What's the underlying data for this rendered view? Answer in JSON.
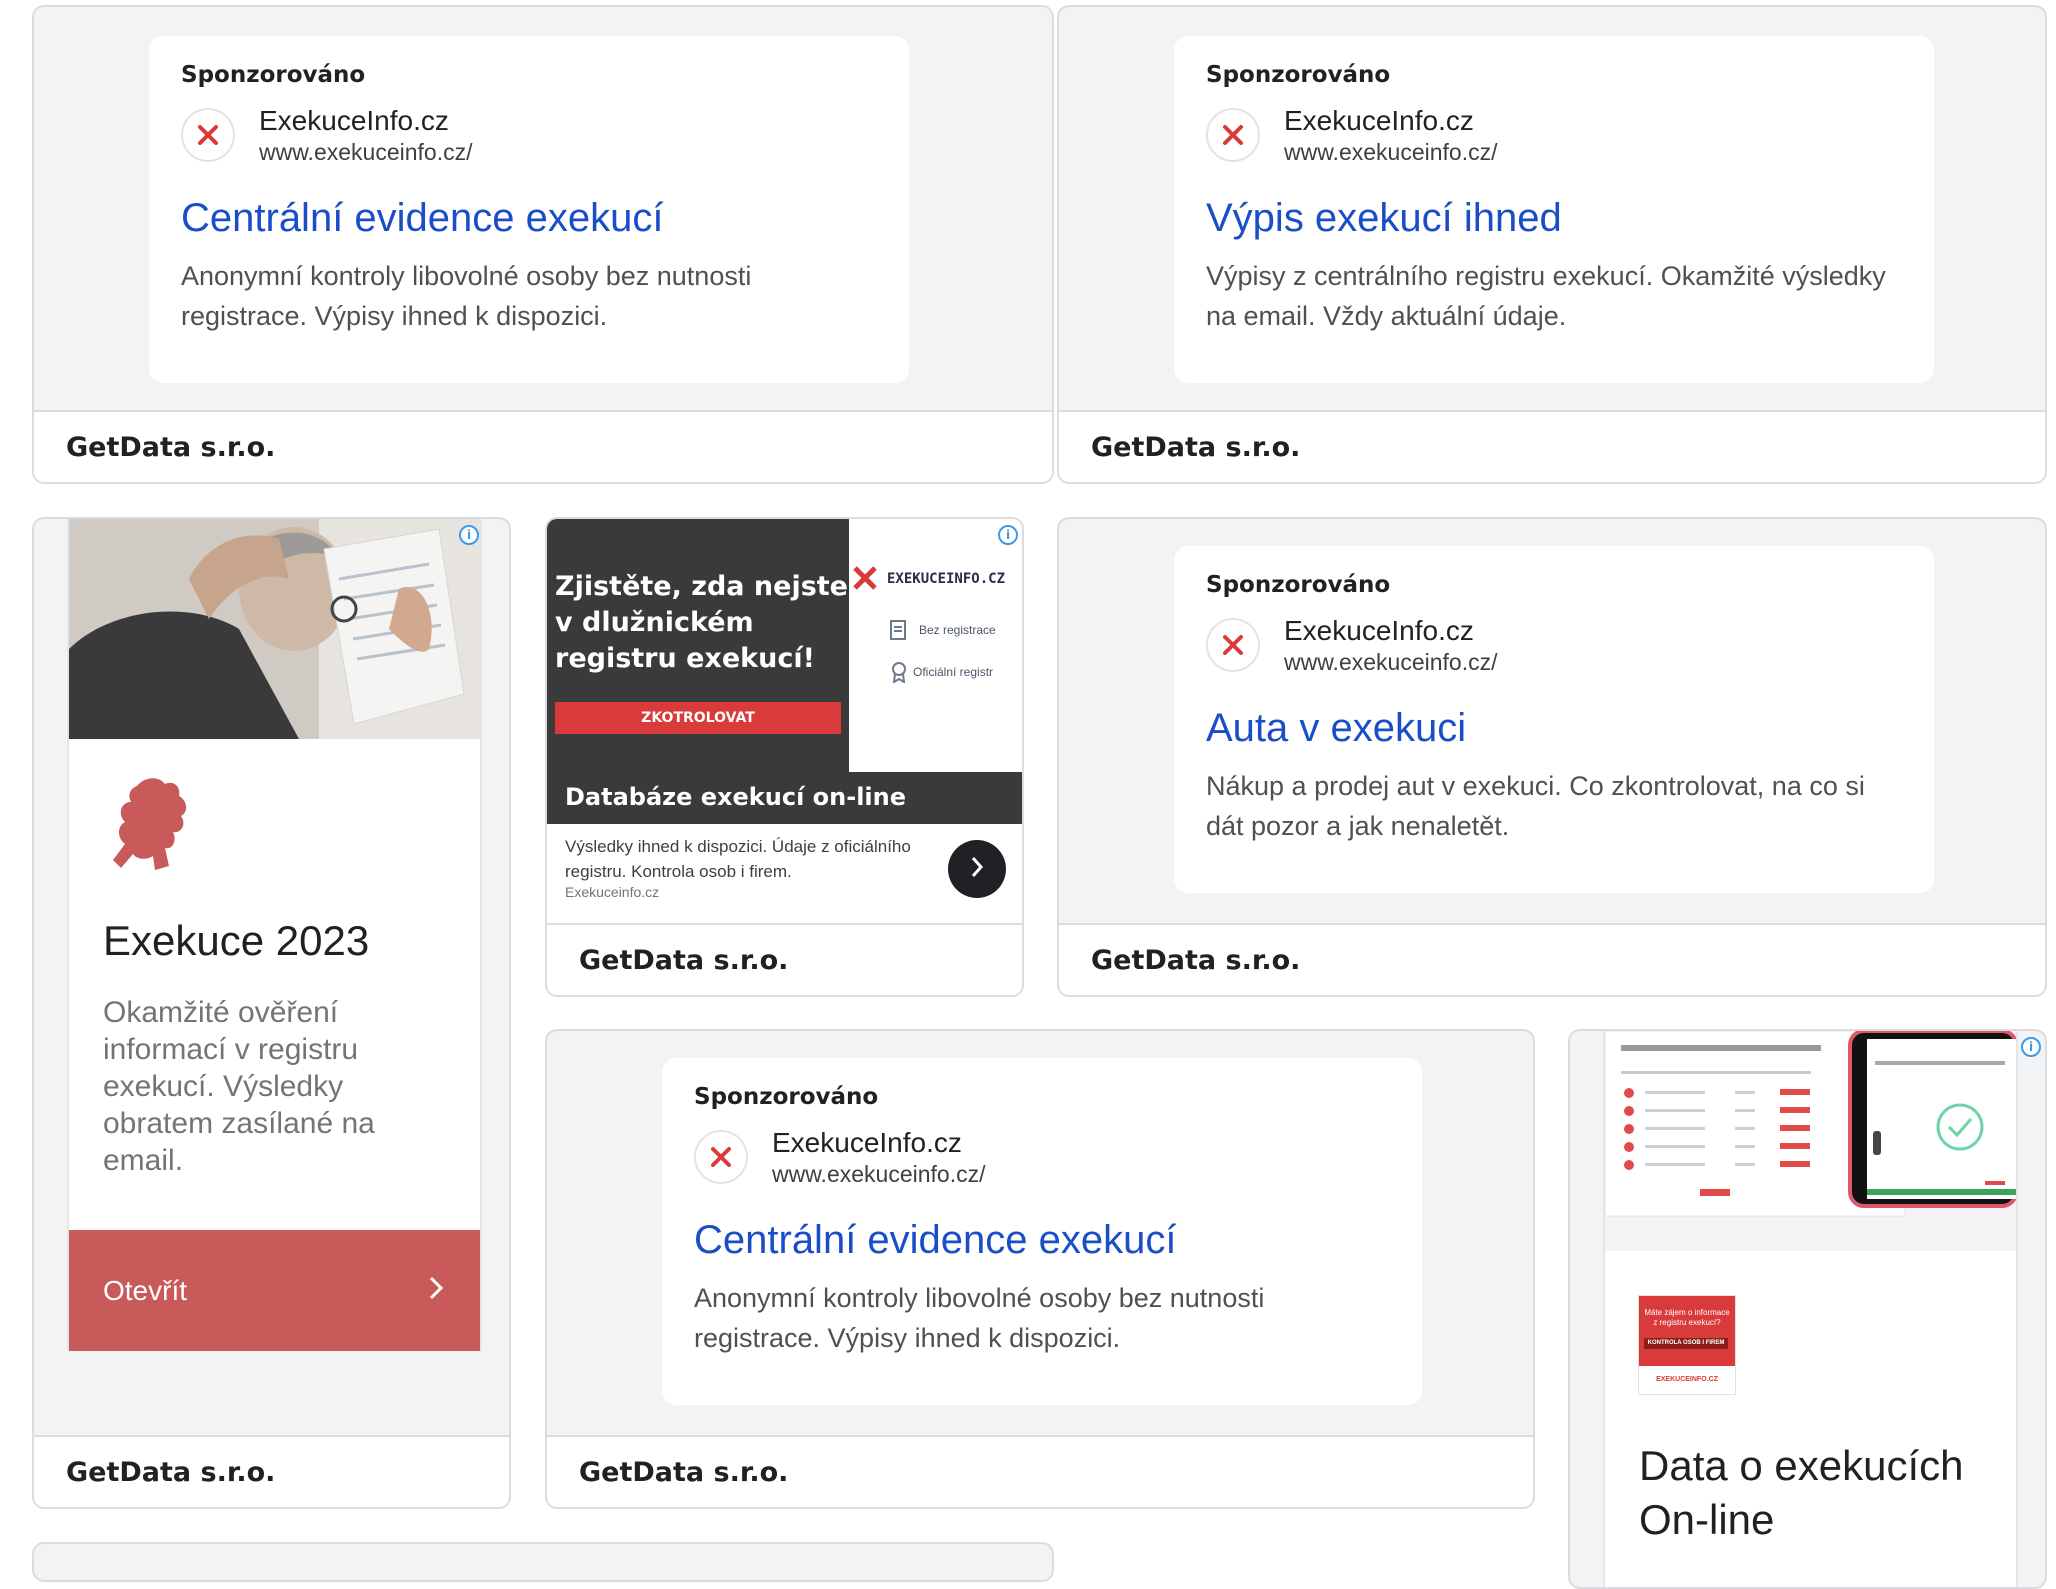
{
  "advertiser": {
    "sponsored_label": "Sponzorováno",
    "name": "ExekuceInfo.cz",
    "url": "www.exekuceinfo.cz/",
    "footer": "GetData s.r.o."
  },
  "ads": {
    "a1": {
      "headline": "Centrální evidence exekucí",
      "description": "Anonymní kontroly libovolné osoby bez nutnosti registrace. Výpisy ihned k dispozici."
    },
    "a2": {
      "headline": "Výpis exekucí ihned",
      "description": "Výpisy z centrálního registru exekucí. Okamžité výsledky na email. Vždy aktuální údaje."
    },
    "a3": {
      "headline": "Auta v exekuci",
      "description": "Nákup a prodej aut v exekuci. Co zkontrolovat, na co si dát pozor a jak nenaletět."
    },
    "a4": {
      "headline": "Centrální evidence exekucí",
      "description": "Anonymní kontroly libovolné osoby bez nutnosti registrace. Výpisy ihned k dispozici."
    }
  },
  "tall_ad": {
    "title": "Exekuce 2023",
    "description": "Okamžité ověření informací v registru exekucí. Výsledky obratem zasílané na email.",
    "button_label": "Otevřít",
    "button_color": "#c85a5a"
  },
  "banner_ad": {
    "headline_lines": [
      "Zjistěte, zda nejste",
      "v dlužnickém",
      "registru exekucí!"
    ],
    "cta": "ZKOTROLOVAT",
    "logo_text": "EXEKUCEINFO.CZ",
    "feature_1": "Bez registrace",
    "feature_2": "Oficiální registr",
    "bar_title": "Databáze exekucí on-line",
    "body": "Výsledky ihned k dispozici. Údaje z oficiálního registru. Kontrola osob i firem.",
    "domain": "Exekuceinfo.cz",
    "cta_color": "#d93a3a"
  },
  "right_ad": {
    "title": "Data o exekucích On-line",
    "mini_text": "Máte zájem o informace z registru exekucí?",
    "mini_button": "KONTROLA OSOB I FIREM",
    "mini_logo": "EXEKUCEINFO.CZ"
  },
  "colors": {
    "link_blue": "#1a4dc8",
    "brand_red": "#d93a3a",
    "card_gray": "#f1f3f4"
  }
}
